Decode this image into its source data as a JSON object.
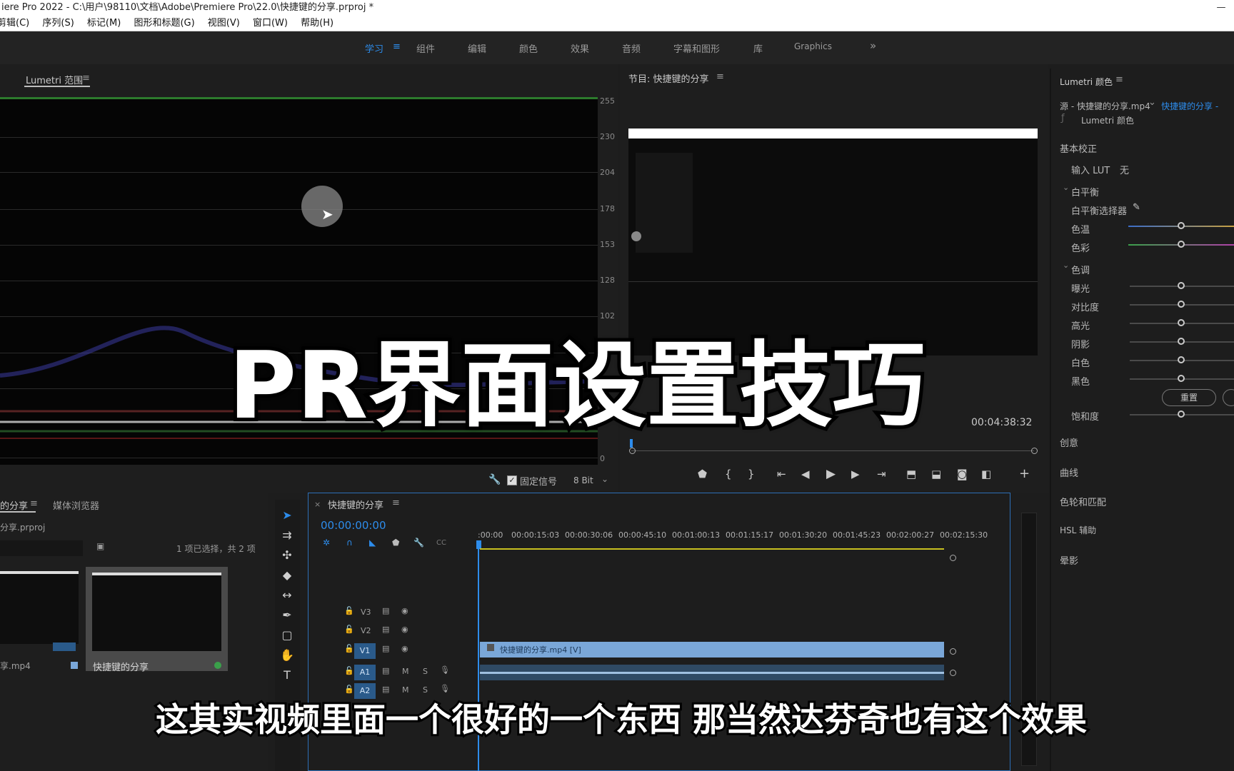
{
  "window": {
    "title": "iere Pro 2022 - C:\\用户\\98110\\文档\\Adobe\\Premiere Pro\\22.0\\快捷键的分享.prproj *"
  },
  "menu": [
    "剪辑(C)",
    "序列(S)",
    "标记(M)",
    "图形和标题(G)",
    "视图(V)",
    "窗口(W)",
    "帮助(H)"
  ],
  "workspaces": {
    "tabs": [
      "学习",
      "组件",
      "编辑",
      "颜色",
      "效果",
      "音频",
      "字幕和图形",
      "库",
      "Graphics"
    ],
    "active": "学习",
    "overflow": "»"
  },
  "scope_panel": {
    "title": "Lumetri 范围",
    "scale": [
      "255",
      "230",
      "204",
      "178",
      "153",
      "128",
      "102",
      "0"
    ],
    "clamp_signal": "固定信号",
    "bit_depth": "8 Bit"
  },
  "program_monitor": {
    "title": "节目: 快捷键的分享",
    "duration": "00:04:38:32"
  },
  "lumetri_color": {
    "title": "Lumetri 颜色",
    "source": "源 - 快捷键的分享.mp4",
    "sequence": "快捷键的分享 -",
    "effect": "Lumetri 颜色",
    "basic_correction": "基本校正",
    "input_lut_label": "输入 LUT",
    "input_lut_value": "无",
    "white_balance": "白平衡",
    "wb_selector": "白平衡选择器",
    "temperature": "色温",
    "tint": "色彩",
    "tone": "色调",
    "exposure": "曝光",
    "contrast": "对比度",
    "highlights": "高光",
    "shadows": "阴影",
    "whites": "白色",
    "blacks": "黑色",
    "reset": "重置",
    "saturation": "饱和度",
    "sections": [
      "创意",
      "曲线",
      "色轮和匹配",
      "HSL 辅助",
      "晕影"
    ]
  },
  "project_panel": {
    "tab": "的分享",
    "media_browser": "媒体浏览器",
    "project_file": "分享.prproj",
    "selection": "1 项已选择，共 2 项",
    "items": [
      "享.mp4",
      "快捷键的分享"
    ]
  },
  "timeline": {
    "title": "快捷键的分享",
    "timecode": "00:00:00:00",
    "ticks": [
      ":00:00",
      "00:00:15:03",
      "00:00:30:06",
      "00:00:45:10",
      "00:01:00:13",
      "00:01:15:17",
      "00:01:30:20",
      "00:01:45:23",
      "00:02:00:27",
      "00:02:15:30"
    ],
    "video_tracks": [
      "V3",
      "V2",
      "V1"
    ],
    "audio_tracks": [
      "A1",
      "A2"
    ],
    "clip_label": "快捷键的分享.mp4 [V]",
    "mute": "M",
    "solo": "S"
  },
  "overlay": {
    "big_title": "PR界面设置技巧",
    "subtitle": "这其实视频里面一个很好的一个东西 那当然达芬奇也有这个效果"
  },
  "colors": {
    "accent": "#2d8ceb",
    "clip_blue": "#7aa7d8",
    "panel_bg": "#1e1e1e"
  }
}
